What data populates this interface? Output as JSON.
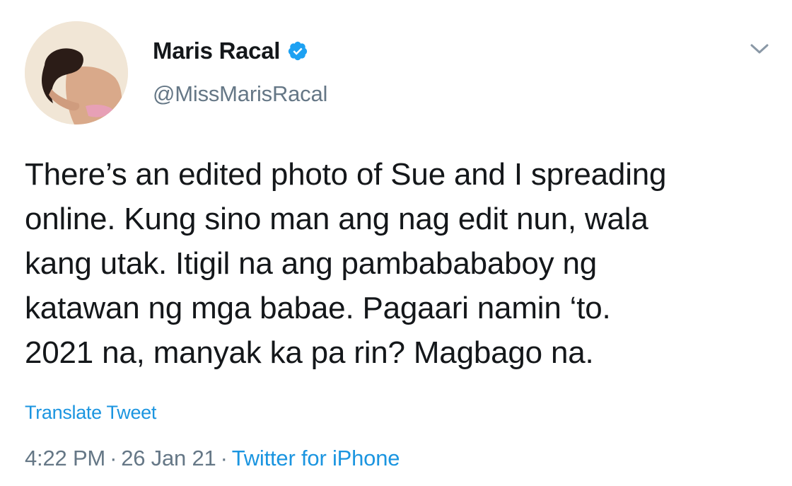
{
  "tweet": {
    "author": {
      "name": "Maris Racal",
      "handle": "@MissMarisRacal",
      "verified": true
    },
    "text": "There’s an edited photo of Sue and I spreading\nonline.  Kung sino man ang nag edit nun, wala\nkang utak. Itigil na ang pambabababoy ng\nkatawan ng mga babae. Pagaari namin ‘to.\n2021 na, manyak ka pa rin? Magbago na.",
    "translate_label": "Translate Tweet",
    "time": "4:22 PM",
    "separator": "·",
    "date": "26 Jan 21",
    "source": "Twitter for iPhone"
  },
  "colors": {
    "link": "#1b95e0",
    "secondary_text": "#657786",
    "primary_text": "#14171a",
    "verified_badge": "#1da1f2"
  },
  "icons": {
    "verified": "verified-badge-icon",
    "menu": "chevron-down-icon"
  }
}
